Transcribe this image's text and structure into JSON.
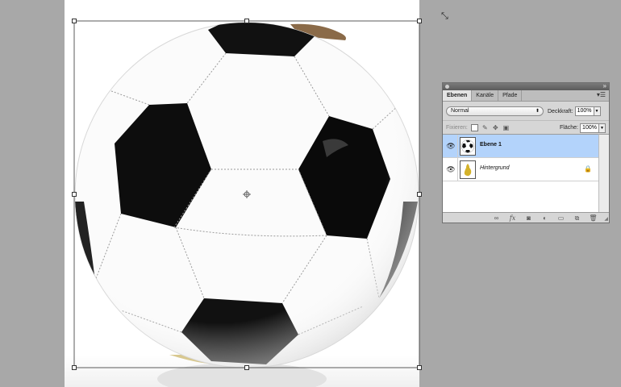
{
  "layers_panel": {
    "tabs": [
      {
        "label": "Ebenen",
        "active": true
      },
      {
        "label": "Kanäle",
        "active": false
      },
      {
        "label": "Pfade",
        "active": false
      }
    ],
    "blend_mode": "Normal",
    "opacity_label": "Deckkraft:",
    "opacity_value": "100%",
    "lock_label": "Fixieren:",
    "fill_label": "Fläche:",
    "fill_value": "100%",
    "layers": [
      {
        "name": "Ebene 1",
        "selected": true,
        "visible": true,
        "locked": false
      },
      {
        "name": "Hintergrund",
        "selected": false,
        "visible": true,
        "locked": true
      }
    ],
    "footer_icons": [
      "link-icon",
      "fx-icon",
      "mask-icon",
      "adjustment-icon",
      "folder-icon",
      "new-layer-icon",
      "trash-icon"
    ]
  },
  "colors": {
    "workspace": "#a8a8a8",
    "canvas": "#ffffff",
    "selected_layer": "#b3d3fb",
    "panel": "#d6d6d6"
  }
}
